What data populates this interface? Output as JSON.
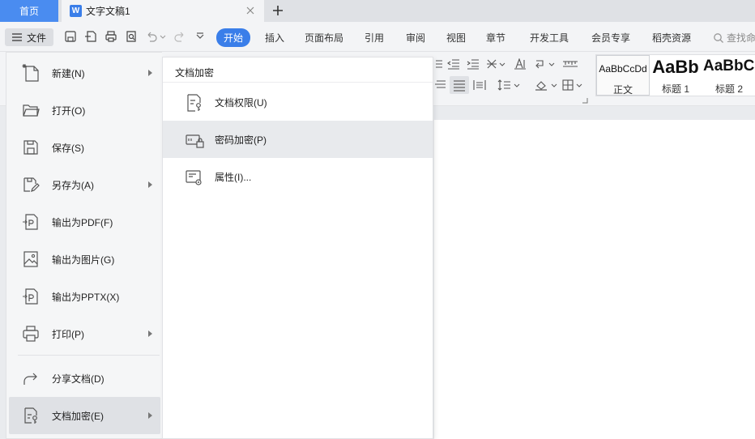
{
  "tabs": {
    "home": "首页",
    "doc_icon_letter": "W",
    "doc_title": "文字文稿1"
  },
  "toolbar": {
    "file_label": "文件",
    "menus": [
      {
        "label": "开始",
        "active": true
      },
      {
        "label": "插入"
      },
      {
        "label": "页面布局"
      },
      {
        "label": "引用"
      },
      {
        "label": "审阅"
      },
      {
        "label": "视图"
      },
      {
        "label": "章节"
      },
      {
        "label": "开发工具"
      },
      {
        "label": "会员专享"
      },
      {
        "label": "稻壳资源"
      }
    ],
    "search": "查找命"
  },
  "styles": [
    {
      "sample": "AaBbCcDd",
      "name": "正文",
      "selected": true
    },
    {
      "sample": "AaBb",
      "name": "标题 1"
    },
    {
      "sample": "AaBbC",
      "name": "标题 2"
    }
  ],
  "file_menu": {
    "items": [
      {
        "label": "新建(N)",
        "icon": "new-doc-icon",
        "submenu": true
      },
      {
        "label": "打开(O)",
        "icon": "folder-icon"
      },
      {
        "label": "保存(S)",
        "icon": "save-icon"
      },
      {
        "label": "另存为(A)",
        "icon": "save-as-icon",
        "submenu": true
      },
      {
        "label": "输出为PDF(F)",
        "icon": "export-pdf-icon"
      },
      {
        "label": "输出为图片(G)",
        "icon": "export-image-icon"
      },
      {
        "label": "输出为PPTX(X)",
        "icon": "export-pptx-icon"
      },
      {
        "label": "打印(P)",
        "icon": "print-icon",
        "submenu": true
      },
      {
        "label": "分享文档(D)",
        "icon": "share-icon"
      },
      {
        "label": "文档加密(E)",
        "icon": "encrypt-icon",
        "submenu": true,
        "active": true
      }
    ]
  },
  "submenu": {
    "title": "文档加密",
    "items": [
      {
        "label": "文档权限(U)",
        "icon": "doc-permission-icon"
      },
      {
        "label": "密码加密(P)",
        "icon": "password-lock-icon",
        "hover": true
      },
      {
        "label": "属性(I)...",
        "icon": "properties-icon"
      }
    ]
  },
  "colors": {
    "accent": "#3a7ee9",
    "home_tab": "#4a8cf0",
    "menu_bg": "#f5f6f7",
    "hover_bg": "#e8eaed"
  }
}
